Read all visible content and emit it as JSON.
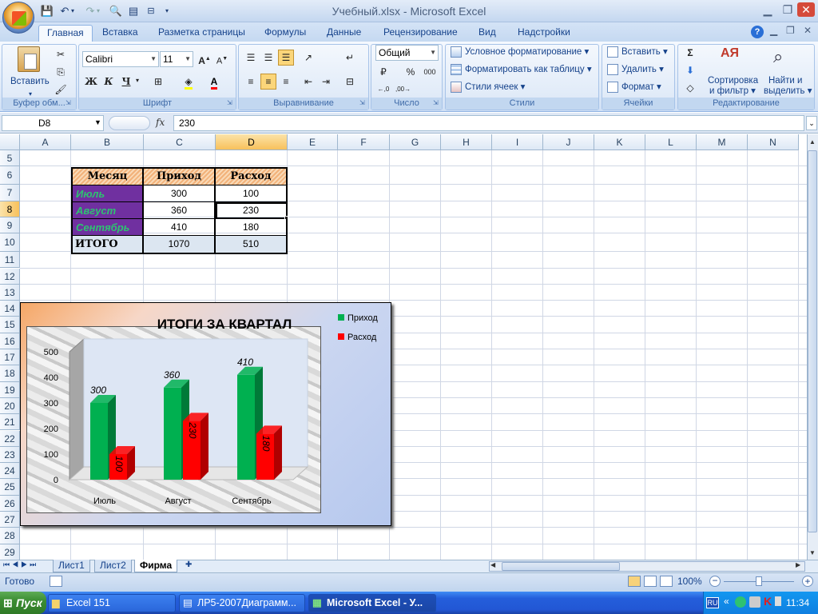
{
  "window": {
    "title": "Учебный.xlsx - Microsoft Excel",
    "ribbon_min_icon": "minimize-icon",
    "controls": [
      "minimize-icon",
      "restore-icon",
      "close-icon"
    ]
  },
  "quick_access": [
    "save-icon",
    "undo-icon",
    "redo-icon",
    "print-preview-icon",
    "form-icon"
  ],
  "tabs": [
    {
      "label": "Главная"
    },
    {
      "label": "Вставка"
    },
    {
      "label": "Разметка страницы"
    },
    {
      "label": "Формулы"
    },
    {
      "label": "Данные"
    },
    {
      "label": "Рецензирование"
    },
    {
      "label": "Вид"
    },
    {
      "label": "Надстройки"
    }
  ],
  "ribbon": {
    "clipboard": {
      "paste": "Вставить",
      "label": "Буфер обм..."
    },
    "font": {
      "name": "Calibri",
      "size": "11",
      "bold": "Ж",
      "italic": "К",
      "underline": "Ч",
      "label": "Шрифт"
    },
    "alignment": {
      "label": "Выравнивание"
    },
    "number": {
      "format": "Общий",
      "label": "Число"
    },
    "styles": {
      "conditional": "Условное форматирование",
      "as_table": "Форматировать как таблицу",
      "cell_styles": "Стили ячеек",
      "label": "Стили"
    },
    "cells": {
      "insert": "Вставить",
      "delete": "Удалить",
      "format": "Формат",
      "label": "Ячейки"
    },
    "editing": {
      "sort_line1": "Сортировка",
      "sort_line2": "и фильтр",
      "find_line1": "Найти и",
      "find_line2": "выделить",
      "label": "Редактирование"
    }
  },
  "formula_bar": {
    "name_box": "D8",
    "fx": "fx",
    "value": "230"
  },
  "columns": [
    "A",
    "B",
    "C",
    "D",
    "E",
    "F",
    "G",
    "H",
    "I",
    "J",
    "K",
    "L",
    "M",
    "N"
  ],
  "rows": [
    "5",
    "6",
    "7",
    "8",
    "9",
    "10",
    "11",
    "12",
    "13",
    "14",
    "15",
    "16",
    "17",
    "18",
    "19",
    "20",
    "21",
    "22",
    "23",
    "24",
    "25",
    "26",
    "27",
    "28",
    "29"
  ],
  "selected": {
    "col": "D",
    "row": "8"
  },
  "table": {
    "headers": [
      "Месяц",
      "Приход",
      "Расход"
    ],
    "rows": [
      [
        "Июль",
        "300",
        "100"
      ],
      [
        "Август",
        "360",
        "230"
      ],
      [
        "Сентябрь",
        "410",
        "180"
      ]
    ],
    "total": [
      "ИТОГО",
      "1070",
      "510"
    ]
  },
  "chart_data": {
    "type": "bar",
    "title": "ИТОГИ ЗА КВАРТАЛ",
    "categories": [
      "Июль",
      "Август",
      "Сентябрь"
    ],
    "series": [
      {
        "name": "Приход",
        "values": [
          300,
          360,
          410
        ],
        "color": "#00b050"
      },
      {
        "name": "Расход",
        "values": [
          100,
          230,
          180
        ],
        "color": "#ff0000"
      }
    ],
    "ylim": [
      0,
      500
    ],
    "yticks": [
      "0",
      "100",
      "200",
      "300",
      "400",
      "500"
    ],
    "legend": "top-right",
    "data_labels": [
      "300",
      "100",
      "360",
      "230",
      "410",
      "180"
    ]
  },
  "sheets": [
    {
      "label": "Лист1"
    },
    {
      "label": "Лист2"
    },
    {
      "label": "Фирма"
    }
  ],
  "status": {
    "ready": "Готово",
    "zoom": "100%"
  },
  "taskbar": {
    "start": "Пуск",
    "tasks": [
      "Excel 151",
      "ЛР5-2007Диаграмм...",
      "Microsoft Excel - У..."
    ],
    "lang": "RU",
    "time": "11:34"
  }
}
